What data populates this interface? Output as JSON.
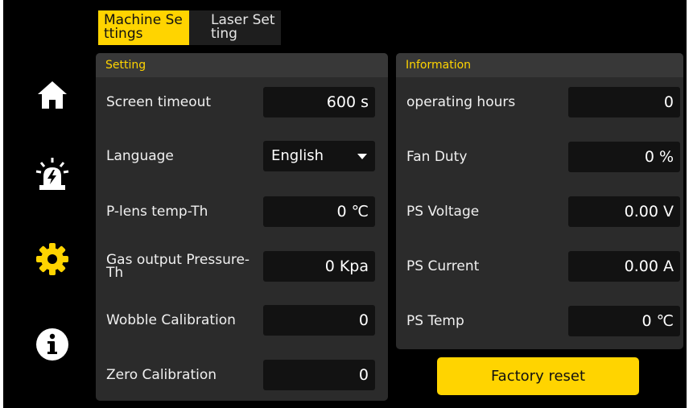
{
  "tabs": [
    {
      "label": "Machine Settings",
      "active": true
    },
    {
      "label": "Laser Setting",
      "active": false
    }
  ],
  "sidebar": {
    "items": [
      {
        "icon": "home-icon"
      },
      {
        "icon": "alarm-icon"
      },
      {
        "icon": "gear-icon",
        "active": true
      },
      {
        "icon": "info-icon"
      }
    ]
  },
  "setting": {
    "title": "Setting",
    "screen_timeout_label": "Screen timeout",
    "screen_timeout_value": "600 s",
    "language_label": "Language",
    "language_value": "English",
    "plens_label": "P-lens temp-Th",
    "plens_value": "0 ℃",
    "gas_label": "Gas output Pressure-Th",
    "gas_value": "0 Kpa",
    "wobble_label": "Wobble Calibration",
    "wobble_value": "0",
    "zero_label": "Zero Calibration",
    "zero_value": "0"
  },
  "information": {
    "title": "Information",
    "hours_label": "operating hours",
    "hours_value": "0",
    "fan_label": "Fan Duty",
    "fan_value": "0 %",
    "voltage_label": "PS Voltage",
    "voltage_value": "0.00 V",
    "current_label": "PS Current",
    "current_value": "0.00 A",
    "temp_label": "PS Temp",
    "temp_value": "0 ℃"
  },
  "factory_reset_label": "Factory reset",
  "colors": {
    "accent": "#ffd400",
    "background": "#000000",
    "panel": "#2b2b2b"
  }
}
